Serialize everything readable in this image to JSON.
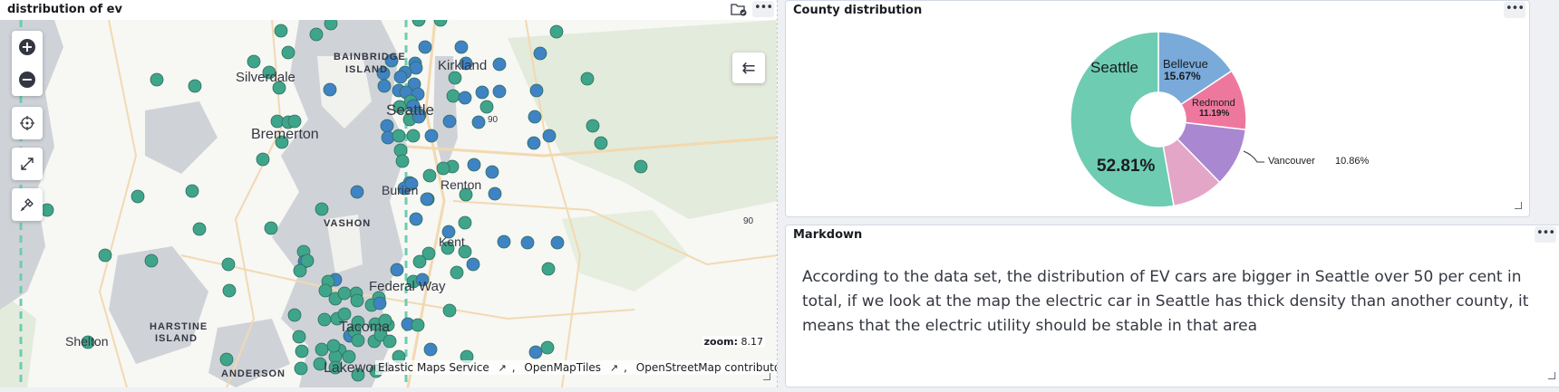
{
  "map": {
    "title": "distribution of ev",
    "zoom_label": "zoom:",
    "zoom_value": "8.17",
    "attribution": [
      "Elastic Maps Service",
      "OpenMapTiles",
      "OpenStreetMap contributors"
    ],
    "place_labels": [
      "Silverdale",
      "BAINBRIDGE",
      "ISLAND",
      "Kirkland",
      "Seattle",
      "Bremerton",
      "Burien",
      "Renton",
      "VASHON",
      "Kent",
      "Federal Way",
      "HARSTINE",
      "ISLAND",
      "Shelton",
      "Tacoma",
      "ANDERSON",
      "Lakewood",
      "90",
      "90"
    ],
    "controls": [
      "zoom-in-icon",
      "zoom-out-icon",
      "crosshair-icon",
      "expand-icon",
      "draw-tool-icon"
    ],
    "colors": {
      "water": "#cfd3d8",
      "land": "#f7f7f4",
      "green": "#e3ebdc",
      "dot_green": "#3fa58a",
      "dot_blue": "#3f83c4",
      "road": "#f2d9b0"
    }
  },
  "county": {
    "title": "County distribution",
    "slices": [
      {
        "name": "Bellevue",
        "percent": "15.67%",
        "value": 15.67,
        "color": "#79aad9"
      },
      {
        "name": "Redmond",
        "percent": "11.19%",
        "value": 11.19,
        "color": "#ee789d"
      },
      {
        "name": "Vancouver",
        "percent": "10.86%",
        "value": 10.86,
        "color": "#a987d1"
      },
      {
        "name": "",
        "percent": "",
        "value": 9.47,
        "color": "#e4a6c7"
      },
      {
        "name": "Seattle",
        "percent": "52.81%",
        "value": 52.81,
        "color": "#6dccb1"
      }
    ]
  },
  "markdown": {
    "title": "Markdown",
    "text": "According to the data set, the distribution of EV cars are bigger in Seattle over 50 per cent in total, if we look at the map the electric car in Seattle has thick density than another county, it means that the electric utility should be stable in that area"
  },
  "chart_data": {
    "type": "pie",
    "title": "County distribution",
    "categories": [
      "Seattle",
      "Bellevue",
      "Redmond",
      "Vancouver",
      ""
    ],
    "values": [
      52.81,
      15.67,
      11.19,
      10.86,
      9.47
    ]
  }
}
